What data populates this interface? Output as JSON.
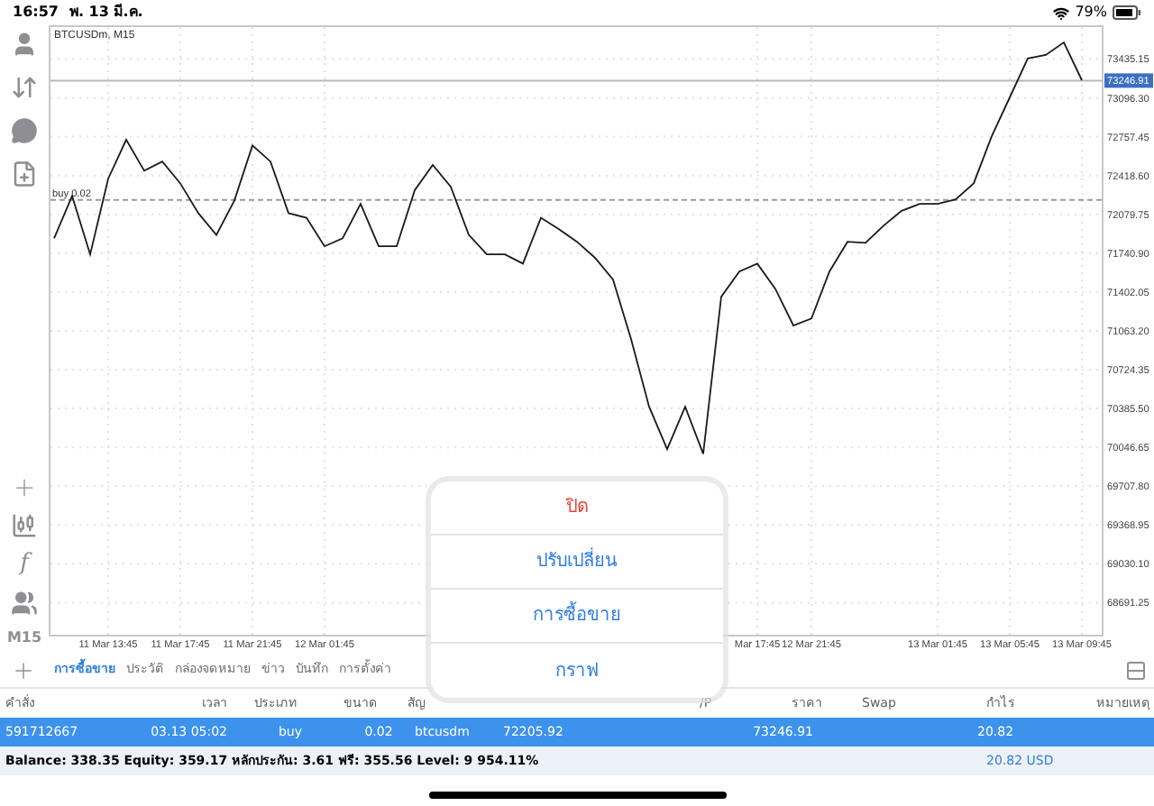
{
  "status_bar": {
    "time": "16:57",
    "date": "พ. 13 มี.ค.",
    "battery": "79%"
  },
  "toolbar": {
    "function_label": "f",
    "timeframe": "M15"
  },
  "chart": {
    "chart_data": {
      "type": "line",
      "title": "BTCUSDm, M15",
      "grid": true,
      "ylim": [
        68411.3,
        73729.8
      ],
      "ref_lines": [
        {
          "axis": "y",
          "value": 73246.91,
          "label": "73246.91"
        },
        {
          "axis": "y",
          "value": 72205.92,
          "label": "buy 0.02"
        }
      ],
      "categories": [
        null,
        null,
        null,
        "11 Mar 13:45",
        null,
        null,
        null,
        "11 Mar 17:45",
        null,
        null,
        null,
        "11 Mar 21:45",
        null,
        null,
        null,
        "12 Mar 01:45",
        null,
        null,
        null,
        null,
        null,
        null,
        null,
        null,
        null,
        null,
        null,
        null,
        null,
        null,
        null,
        null,
        null,
        null,
        null,
        null,
        null,
        null,
        null,
        "Mar 17:45",
        null,
        null,
        "12 Mar 21:45",
        null,
        null,
        null,
        null,
        null,
        null,
        "13 Mar 01:45",
        null,
        null,
        null,
        "13 Mar 05:45",
        null,
        null,
        null,
        "13 Mar 09:45"
      ],
      "yticks": [
        {
          "value": 73435.15,
          "label": "73435.15"
        },
        {
          "value": 73096.3,
          "label": "73096.30"
        },
        {
          "value": 72757.45,
          "label": "72757.45"
        },
        {
          "value": 72418.6,
          "label": "72418.60"
        },
        {
          "value": 72079.75,
          "label": "72079.75"
        },
        {
          "value": 71740.9,
          "label": "71740.90"
        },
        {
          "value": 71402.05,
          "label": "71402.05"
        },
        {
          "value": 71063.2,
          "label": "71063.20"
        },
        {
          "value": 70724.35,
          "label": "70724.35"
        },
        {
          "value": 70385.5,
          "label": "70385.50"
        },
        {
          "value": 70046.65,
          "label": "70046.65"
        },
        {
          "value": 69707.8,
          "label": "69707.80"
        },
        {
          "value": 69368.95,
          "label": "69368.95"
        },
        {
          "value": 69030.1,
          "label": "69030.10"
        },
        {
          "value": 68691.25,
          "label": "68691.25"
        }
      ],
      "series": [
        {
          "color": "#1a1a1a",
          "values": [
            71870,
            72240,
            71730,
            72390,
            72730,
            72460,
            72540,
            72350,
            72090,
            71900,
            72200,
            72680,
            72540,
            72090,
            72050,
            71800,
            71870,
            72170,
            71800,
            71800,
            72290,
            72510,
            72320,
            71900,
            71730,
            71730,
            71650,
            72050,
            71950,
            71840,
            71700,
            71510,
            70990,
            70400,
            70030,
            70400,
            69990,
            71360,
            71580,
            71650,
            71430,
            71110,
            71170,
            71580,
            71840,
            71830,
            71980,
            72110,
            72170,
            72170,
            72210,
            72350,
            72760,
            73100,
            73440,
            73470,
            73580,
            73250
          ]
        }
      ]
    }
  },
  "tabs": [
    {
      "label": "การซื้อขาย",
      "selected": true
    },
    {
      "label": "ประวัติ",
      "selected": false
    },
    {
      "label": "กล่องจดหมาย",
      "selected": false
    },
    {
      "label": "ข่าว",
      "selected": false
    },
    {
      "label": "บันทึก",
      "selected": false
    },
    {
      "label": "การตั้งค่า",
      "selected": false
    }
  ],
  "table": {
    "columns": [
      "คำสั่ง",
      "เวลา",
      "ประเภท",
      "ขนาด",
      "สัญ",
      "/P",
      "ราคา",
      "Swap",
      "กำไร",
      "หมายเหตุ"
    ],
    "rows": [
      {
        "order": "591712667",
        "time": "03.13 05:02",
        "type": "buy",
        "volume": "0.02",
        "symbol": "btcusdm",
        "open_price": "72205.92",
        "current_price": "73246.91",
        "profit": "20.82",
        "selected": true
      }
    ],
    "balance": "Balance: 338.35 Equity: 359.17 หลักประกัน: 3.61 ฟรี: 355.56 Level: 9 954.11%",
    "total_profit": "20.82 USD"
  },
  "menu": {
    "items": [
      {
        "label": "ปิด",
        "kind": "destructive"
      },
      {
        "label": "ปรับเปลี่ยน",
        "kind": "action"
      },
      {
        "label": "การซื้อขาย",
        "kind": "action"
      },
      {
        "label": "กราฟ",
        "kind": "action"
      }
    ]
  }
}
